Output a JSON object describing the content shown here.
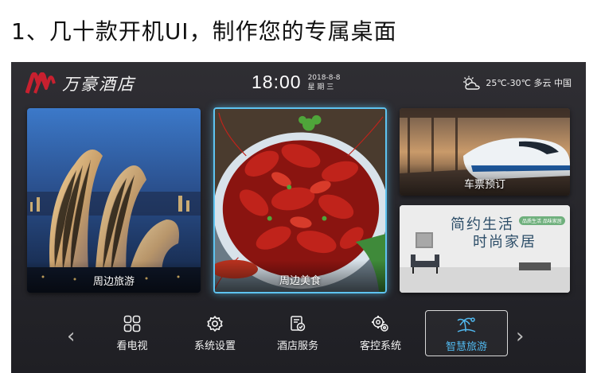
{
  "caption": "1、几十款开机UI，制作您的专属桌面",
  "header": {
    "hotel_name": "万豪酒店",
    "time": "18:00",
    "date": "2018-8-8",
    "weekday": "星 期 三",
    "weather_text": "25℃-30℃ 多云 中国"
  },
  "tiles": {
    "tour": {
      "label": "周边旅游"
    },
    "food": {
      "label": "周边美食"
    },
    "train": {
      "label": "车票预订"
    },
    "home": {
      "title_line1": "简约生活",
      "title_line2": "时尚家居",
      "badge": "品质生活 品味家居"
    }
  },
  "menu": {
    "items": [
      {
        "label": "看电视",
        "icon": "grid-icon"
      },
      {
        "label": "系统设置",
        "icon": "gear-icon"
      },
      {
        "label": "酒店服务",
        "icon": "service-icon"
      },
      {
        "label": "客控系统",
        "icon": "gears-icon"
      },
      {
        "label": "智慧旅游",
        "icon": "island-icon"
      }
    ],
    "active_index": 4
  },
  "colors": {
    "background": "#2a2a2f",
    "accent": "#51b8ee",
    "focus_border": "#5ec3f0",
    "logo_red": "#c8202f"
  }
}
